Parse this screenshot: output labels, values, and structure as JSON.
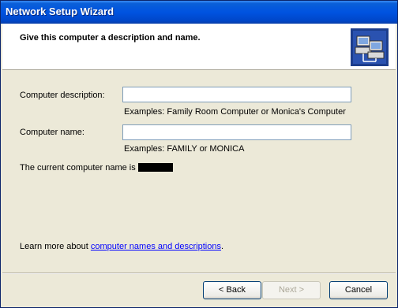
{
  "window": {
    "title": "Network Setup Wizard"
  },
  "header": {
    "title": "Give this computer a description and name.",
    "icon": "network-computers-icon"
  },
  "form": {
    "description_label": "Computer description:",
    "description_value": "",
    "description_hint": "Examples: Family Room Computer or Monica's Computer",
    "name_label": "Computer name:",
    "name_value": "",
    "name_hint": "Examples: FAMILY or MONICA",
    "current_name_text": "The current computer name is"
  },
  "learn_more": {
    "prefix": "Learn more about ",
    "link": "computer names and descriptions",
    "suffix": "."
  },
  "buttons": {
    "back": "< Back",
    "next": "Next >",
    "cancel": "Cancel"
  },
  "colors": {
    "title_bar": "#0053e0",
    "link": "#0000ff",
    "dialog_bg": "#ece9d8"
  }
}
